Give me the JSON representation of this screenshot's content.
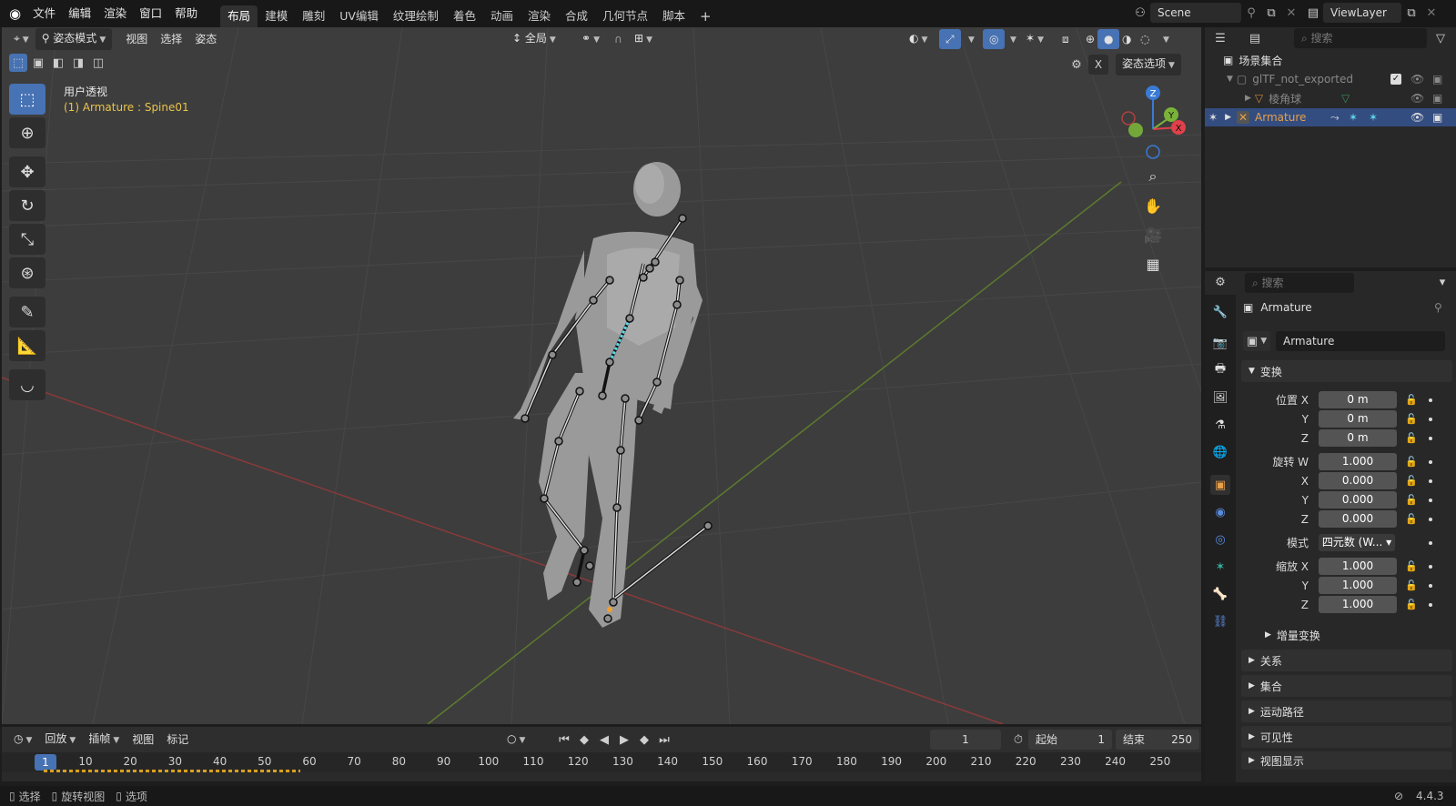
{
  "topbar": {
    "menus": [
      "文件",
      "编辑",
      "渲染",
      "窗口",
      "帮助"
    ],
    "workspaces": [
      "布局",
      "建模",
      "雕刻",
      "UV编辑",
      "纹理绘制",
      "着色",
      "动画",
      "渲染",
      "合成",
      "几何节点",
      "脚本"
    ],
    "active_workspace": "布局",
    "scene": "Scene",
    "view_layer": "ViewLayer"
  },
  "viewport": {
    "mode": "姿态模式",
    "menus": [
      "视图",
      "选择",
      "姿态"
    ],
    "transform_orientation": "全局",
    "pose_options": "姿态选项",
    "x_toggle": "X",
    "info_view": "用户透视",
    "info_object": "(1) Armature : Spine01",
    "axis_labels": {
      "z": "Z",
      "y": "Y",
      "x": "X"
    }
  },
  "timeline": {
    "menus": [
      "回放",
      "插帧",
      "视图",
      "标记"
    ],
    "current_frame": "1",
    "start_label": "起始",
    "start_value": "1",
    "end_label": "结束",
    "end_value": "250",
    "ruler_current": "1",
    "ruler_ticks": [
      "10",
      "20",
      "30",
      "40",
      "50",
      "60",
      "70",
      "80",
      "90",
      "100",
      "110",
      "120",
      "130",
      "140",
      "150",
      "160",
      "170",
      "180",
      "190",
      "200",
      "210",
      "220",
      "230",
      "240",
      "250"
    ]
  },
  "statusbar": {
    "items": [
      "选择",
      "旋转视图",
      "选项"
    ],
    "version": "4.4.3"
  },
  "outliner": {
    "search_placeholder": "搜索",
    "root": "场景集合",
    "collection": "glTF_not_exported",
    "child": "棱角球",
    "armature": "Armature"
  },
  "properties": {
    "search_placeholder": "搜索",
    "object_name": "Armature",
    "datablock_name": "Armature",
    "transform_section": "变换",
    "location_label": "位置 X",
    "location": [
      "0 m",
      "0 m",
      "0 m"
    ],
    "rotation_label": "旋转 W",
    "rotation": [
      "1.000",
      "0.000",
      "0.000",
      "0.000"
    ],
    "mode_label": "模式",
    "mode_value": "四元数 (W...",
    "scale_label": "缩放 X",
    "scale": [
      "1.000",
      "1.000",
      "1.000"
    ],
    "axis_y": "Y",
    "axis_z": "Z",
    "axis_x": "X",
    "delta": "增量变换",
    "sections": [
      "关系",
      "集合",
      "运动路径",
      "可见性",
      "视图显示"
    ]
  },
  "colors": {
    "accent": "#4772b3",
    "active_text": "#e9c44a",
    "armature_orange": "#e8a04a"
  }
}
